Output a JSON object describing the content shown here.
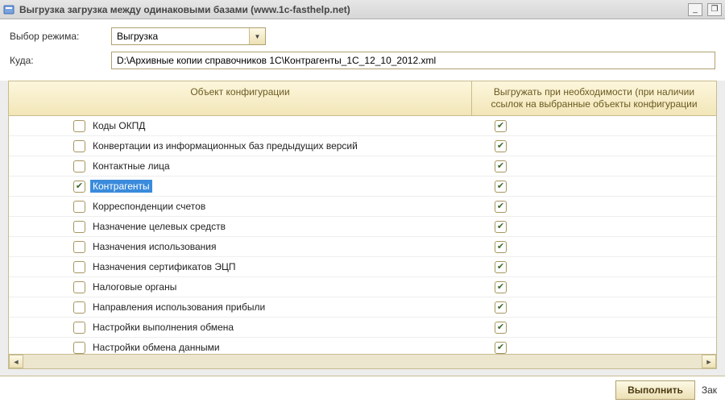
{
  "window": {
    "title": "Выгрузка загрузка между одинаковыми базами (www.1c-fasthelp.net)"
  },
  "form": {
    "mode_label": "Выбор режима:",
    "mode_value": "Выгрузка",
    "path_label": "Куда:",
    "path_value": "D:\\Архивные копии справочников 1С\\Контрагенты_1С_12_10_2012.xml"
  },
  "table": {
    "header_object": "Объект конфигурации",
    "header_export": "Выгружать при необходимости (при наличии ссылок на выбранные объекты конфигурации",
    "rows": [
      {
        "label": "Коды ОКПД",
        "checked": false,
        "export": true,
        "selected": false
      },
      {
        "label": "Конвертации из информационных баз предыдущих версий",
        "checked": false,
        "export": true,
        "selected": false
      },
      {
        "label": "Контактные лица",
        "checked": false,
        "export": true,
        "selected": false
      },
      {
        "label": "Контрагенты",
        "checked": true,
        "export": true,
        "selected": true
      },
      {
        "label": "Корреспонденции счетов",
        "checked": false,
        "export": true,
        "selected": false
      },
      {
        "label": "Назначение целевых средств",
        "checked": false,
        "export": true,
        "selected": false
      },
      {
        "label": "Назначения использования",
        "checked": false,
        "export": true,
        "selected": false
      },
      {
        "label": "Назначения сертификатов ЭЦП",
        "checked": false,
        "export": true,
        "selected": false
      },
      {
        "label": "Налоговые органы",
        "checked": false,
        "export": true,
        "selected": false
      },
      {
        "label": "Направления использования прибыли",
        "checked": false,
        "export": true,
        "selected": false
      },
      {
        "label": "Настройки выполнения обмена",
        "checked": false,
        "export": true,
        "selected": false
      },
      {
        "label": "Настройки обмена данными",
        "checked": false,
        "export": true,
        "selected": false
      }
    ]
  },
  "buttons": {
    "execute": "Выполнить",
    "close": "Зак"
  }
}
